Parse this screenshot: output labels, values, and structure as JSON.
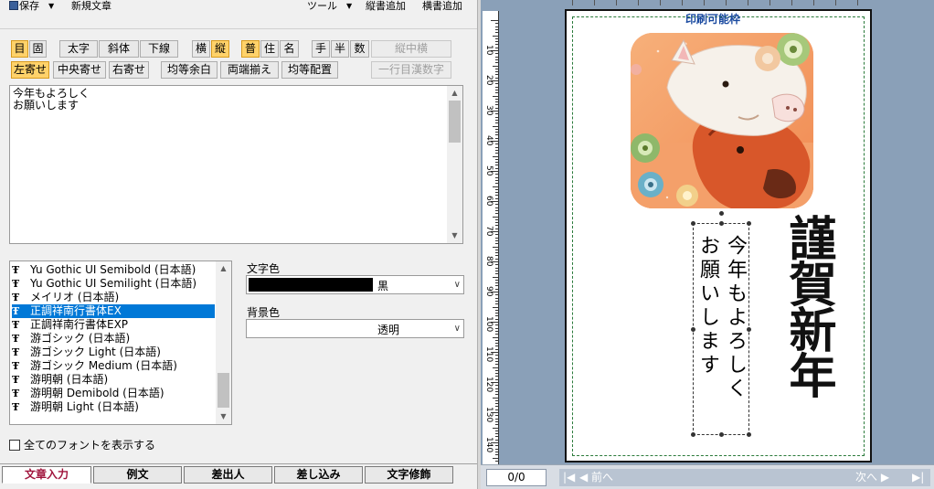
{
  "menu": {
    "save": "保存",
    "new_text": "新規文章",
    "tools": "ツール",
    "add_vertical": "縦書追加",
    "add_horizontal": "横書追加"
  },
  "toolbar": {
    "row1": {
      "moku": "目",
      "ko": "固",
      "bold": "太字",
      "italic": "斜体",
      "underline": "下線",
      "yoko": "横",
      "tate": "縦",
      "fu": "普",
      "ju": "住",
      "mei": "名",
      "te": "手",
      "han": "半",
      "su": "数",
      "tate_chu_yoko": "縦中横"
    },
    "row2": {
      "align_left": "左寄せ",
      "align_center": "中央寄せ",
      "align_right": "右寄せ",
      "even_margin": "均等余白",
      "justify": "両端揃え",
      "even_spacing": "均等配置",
      "first_line_kanji": "一行目漢数字"
    }
  },
  "editor": {
    "text": "今年もよろしく\nお願いします"
  },
  "fonts": {
    "items": [
      "Yu Gothic UI Semibold (日本語)",
      "Yu Gothic UI Semilight (日本語)",
      "メイリオ (日本語)",
      "正調祥南行書体EX",
      "正調祥南行書体EXP",
      "游ゴシック (日本語)",
      "游ゴシック Light (日本語)",
      "游ゴシック Medium (日本語)",
      "游明朝 (日本語)",
      "游明朝 Demibold (日本語)",
      "游明朝 Light (日本語)"
    ],
    "selected_index": 3,
    "show_all_label": "全てのフォントを表示する"
  },
  "colors": {
    "text_color_label": "文字色",
    "text_color_value": "黒",
    "bg_color_label": "背景色",
    "bg_color_value": "透明"
  },
  "tabs": [
    "文章入力",
    "例文",
    "差出人",
    "差し込み",
    "文字修飾"
  ],
  "preview": {
    "print_area_label": "印刷可能枠",
    "greeting": "今年も\nお願い",
    "greeting_line1": "今年もよろしく",
    "greeting_line2": "お願いします",
    "title": "謹賀新年",
    "ruler_labels": [
      "10",
      "20",
      "30",
      "40",
      "50",
      "60",
      "70",
      "80",
      "90",
      "100",
      "110",
      "120",
      "130",
      "140"
    ],
    "page_count": "0/0",
    "prev_label": "◀ 前へ",
    "next_label": "次へ ▶",
    "first_icon": "|◀",
    "last_icon": "▶|"
  }
}
